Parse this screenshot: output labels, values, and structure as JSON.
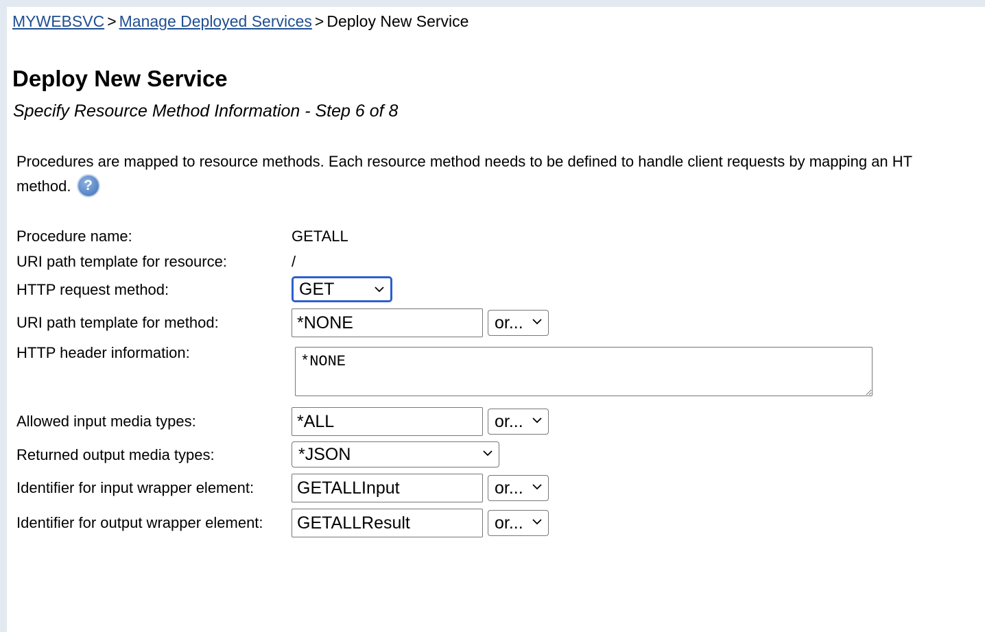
{
  "breadcrumb": {
    "items": [
      "MYWEBSVC",
      "Manage Deployed Services"
    ],
    "current": "Deploy New Service",
    "separator": ">"
  },
  "header": {
    "title": "Deploy New Service",
    "subtitle": "Specify Resource Method Information - Step 6 of 8"
  },
  "description": {
    "line1": "Procedures are mapped to resource methods. Each resource method needs to be defined to handle client requests by mapping an HT",
    "line2": "method.",
    "help_icon": "?"
  },
  "form": {
    "procedure_name": {
      "label": "Procedure name:",
      "value": "GETALL"
    },
    "uri_resource": {
      "label": "URI path template for resource:",
      "value": "/"
    },
    "http_method": {
      "label": "HTTP request method:",
      "value": "GET"
    },
    "uri_method": {
      "label": "URI path template for method:",
      "value": "*NONE",
      "or_label": "or..."
    },
    "http_header": {
      "label": "HTTP header information:",
      "value": "*NONE"
    },
    "input_media": {
      "label": "Allowed input media types:",
      "value": "*ALL",
      "or_label": "or..."
    },
    "output_media": {
      "label": "Returned output media types:",
      "value": "*JSON"
    },
    "input_wrapper": {
      "label": "Identifier for input wrapper element:",
      "value": "GETALLInput",
      "or_label": "or..."
    },
    "output_wrapper": {
      "label": "Identifier for output wrapper element:",
      "value": "GETALLResult",
      "or_label": "or..."
    }
  },
  "colors": {
    "link": "#1f4e92",
    "focus_ring": "#2c5fca",
    "background": "#e3e9f1"
  }
}
